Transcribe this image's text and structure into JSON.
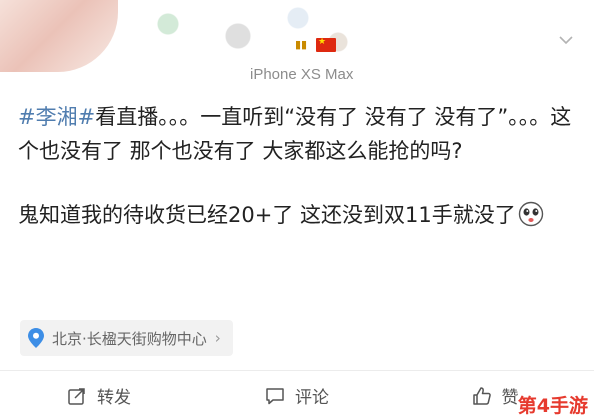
{
  "header": {
    "device": "iPhone XS Max"
  },
  "post": {
    "topic": "#李湘#",
    "line1_rest": "看直播。。。一直听到“没有了 没有了 没有了”。。。这个也没有了 那个也没有了 大家都这么能抢的吗?",
    "line2": "鬼知道我的待收货已经20+了 这还没到双11手就没了"
  },
  "location": {
    "label": "北京·长楹天街购物中心",
    "arrow": "›"
  },
  "actions": {
    "repost": "转发",
    "comment": "评论",
    "like": "赞"
  },
  "watermark": "第4手游",
  "colors": {
    "topic": "#507daf",
    "location_pin": "#3d8ee6",
    "watermark": "#e63a2e"
  },
  "icons": [
    "chevron-down-icon",
    "location-pin-icon",
    "repost-icon",
    "comment-icon",
    "like-icon",
    "emoji-icon"
  ]
}
